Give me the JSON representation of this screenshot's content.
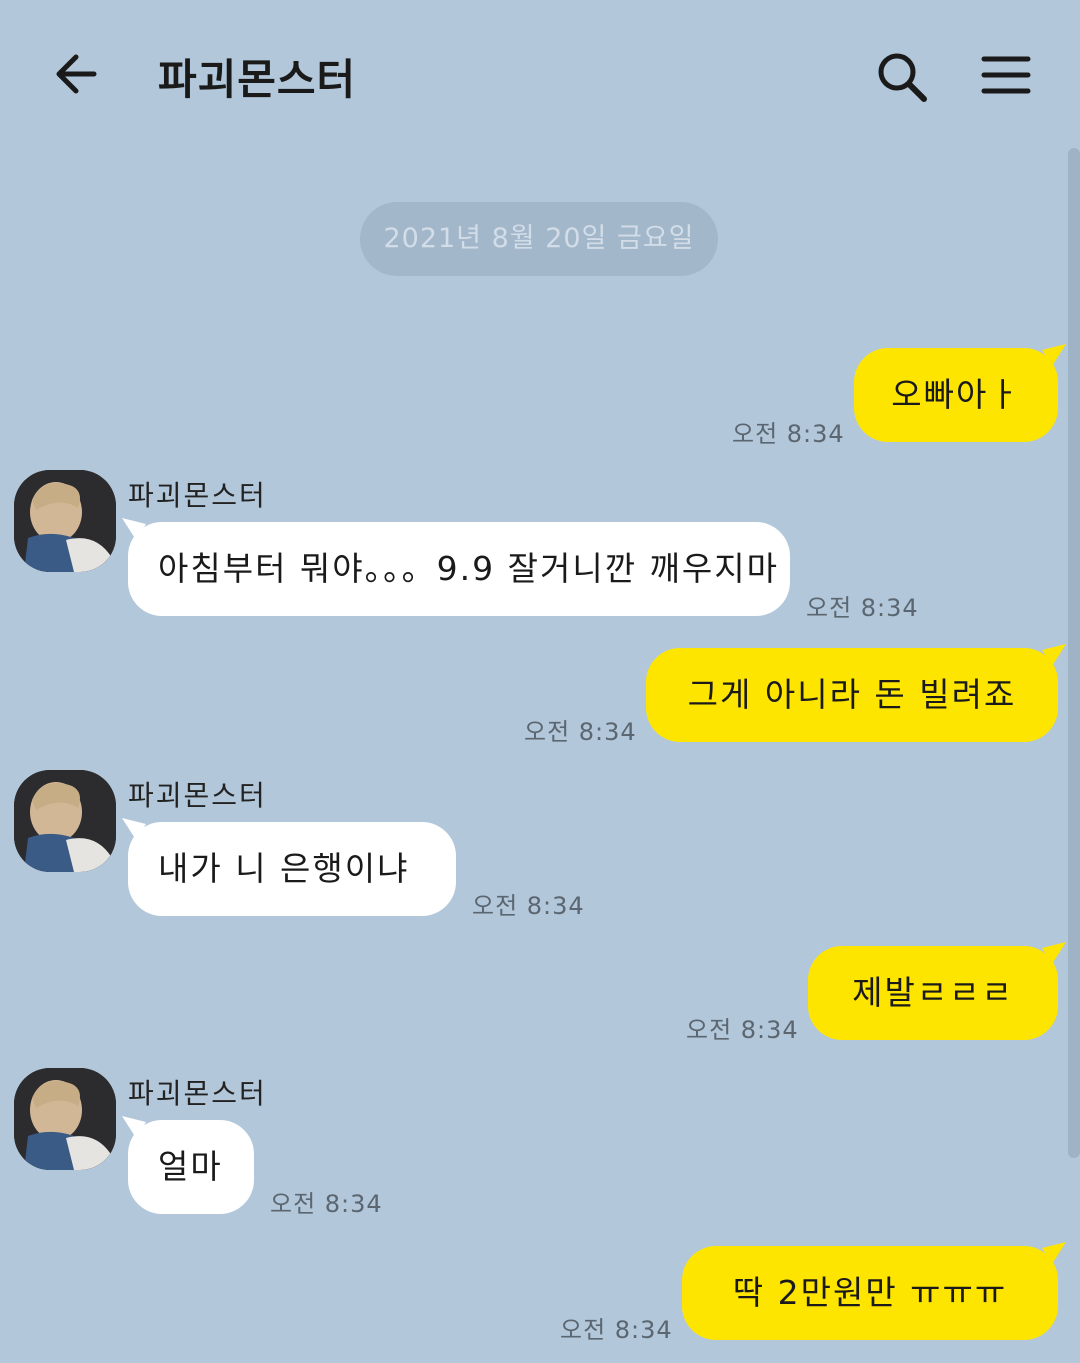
{
  "header": {
    "title": "파괴몬스터"
  },
  "date_divider": "2021년 8월 20일 금요일",
  "messages": [
    {
      "from": "me",
      "text": "오빠아ㅏ",
      "time": "오전 8:34"
    },
    {
      "from": "them",
      "sender": "파괴몬스터",
      "text": "아침부터 뭐야。。。9.9 잘거니깐 깨우지마",
      "time": "오전 8:34"
    },
    {
      "from": "me",
      "text": "그게 아니라 돈 빌려죠",
      "time": "오전 8:34"
    },
    {
      "from": "them",
      "sender": "파괴몬스터",
      "text": "내가 니 은행이냐",
      "time": "오전 8:34"
    },
    {
      "from": "me",
      "text": "제발ㄹㄹㄹ",
      "time": "오전 8:34"
    },
    {
      "from": "them",
      "sender": "파괴몬스터",
      "text": "얼마",
      "time": "오전 8:34"
    },
    {
      "from": "me",
      "text": "딱 2만원만 ㅠㅠㅠ",
      "time": "오전 8:34"
    }
  ],
  "colors": {
    "background": "#b2c7da",
    "my_bubble": "#fee500",
    "their_bubble": "#ffffff"
  },
  "icons": [
    "back-arrow-icon",
    "search-icon",
    "menu-icon"
  ]
}
